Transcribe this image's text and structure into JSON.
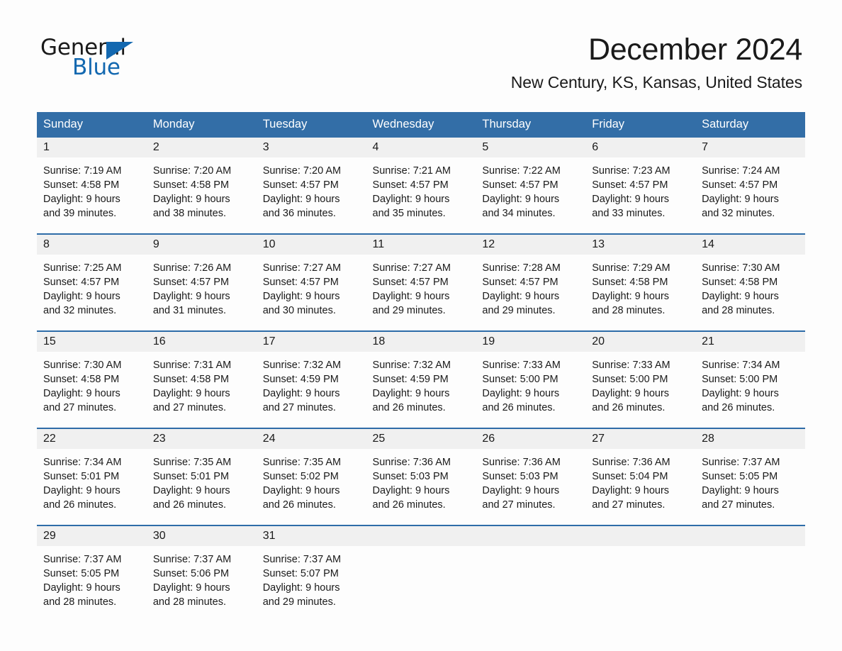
{
  "brand": {
    "word_one": "General",
    "word_two": "Blue",
    "triangle_color": "#1368b0"
  },
  "header": {
    "month_title": "December 2024",
    "location": "New Century, KS, Kansas, United States"
  },
  "theme": {
    "header_blue": "#336ea7",
    "row_divider_blue": "#2e6ca8",
    "daynum_band": "#f0f0f0",
    "page_background": "#fdfdfd",
    "text": "#1a1a1a"
  },
  "weekday_headers": [
    "Sunday",
    "Monday",
    "Tuesday",
    "Wednesday",
    "Thursday",
    "Friday",
    "Saturday"
  ],
  "labels": {
    "sunrise_prefix": "Sunrise:",
    "sunset_prefix": "Sunset:",
    "daylight_prefix": "Daylight:"
  },
  "weeks": [
    [
      {
        "day": "1",
        "line1": "Sunrise: 7:19 AM",
        "line2": "Sunset: 4:58 PM",
        "line3": "Daylight: 9 hours",
        "line4": "and 39 minutes."
      },
      {
        "day": "2",
        "line1": "Sunrise: 7:20 AM",
        "line2": "Sunset: 4:58 PM",
        "line3": "Daylight: 9 hours",
        "line4": "and 38 minutes."
      },
      {
        "day": "3",
        "line1": "Sunrise: 7:20 AM",
        "line2": "Sunset: 4:57 PM",
        "line3": "Daylight: 9 hours",
        "line4": "and 36 minutes."
      },
      {
        "day": "4",
        "line1": "Sunrise: 7:21 AM",
        "line2": "Sunset: 4:57 PM",
        "line3": "Daylight: 9 hours",
        "line4": "and 35 minutes."
      },
      {
        "day": "5",
        "line1": "Sunrise: 7:22 AM",
        "line2": "Sunset: 4:57 PM",
        "line3": "Daylight: 9 hours",
        "line4": "and 34 minutes."
      },
      {
        "day": "6",
        "line1": "Sunrise: 7:23 AM",
        "line2": "Sunset: 4:57 PM",
        "line3": "Daylight: 9 hours",
        "line4": "and 33 minutes."
      },
      {
        "day": "7",
        "line1": "Sunrise: 7:24 AM",
        "line2": "Sunset: 4:57 PM",
        "line3": "Daylight: 9 hours",
        "line4": "and 32 minutes."
      }
    ],
    [
      {
        "day": "8",
        "line1": "Sunrise: 7:25 AM",
        "line2": "Sunset: 4:57 PM",
        "line3": "Daylight: 9 hours",
        "line4": "and 32 minutes."
      },
      {
        "day": "9",
        "line1": "Sunrise: 7:26 AM",
        "line2": "Sunset: 4:57 PM",
        "line3": "Daylight: 9 hours",
        "line4": "and 31 minutes."
      },
      {
        "day": "10",
        "line1": "Sunrise: 7:27 AM",
        "line2": "Sunset: 4:57 PM",
        "line3": "Daylight: 9 hours",
        "line4": "and 30 minutes."
      },
      {
        "day": "11",
        "line1": "Sunrise: 7:27 AM",
        "line2": "Sunset: 4:57 PM",
        "line3": "Daylight: 9 hours",
        "line4": "and 29 minutes."
      },
      {
        "day": "12",
        "line1": "Sunrise: 7:28 AM",
        "line2": "Sunset: 4:57 PM",
        "line3": "Daylight: 9 hours",
        "line4": "and 29 minutes."
      },
      {
        "day": "13",
        "line1": "Sunrise: 7:29 AM",
        "line2": "Sunset: 4:58 PM",
        "line3": "Daylight: 9 hours",
        "line4": "and 28 minutes."
      },
      {
        "day": "14",
        "line1": "Sunrise: 7:30 AM",
        "line2": "Sunset: 4:58 PM",
        "line3": "Daylight: 9 hours",
        "line4": "and 28 minutes."
      }
    ],
    [
      {
        "day": "15",
        "line1": "Sunrise: 7:30 AM",
        "line2": "Sunset: 4:58 PM",
        "line3": "Daylight: 9 hours",
        "line4": "and 27 minutes."
      },
      {
        "day": "16",
        "line1": "Sunrise: 7:31 AM",
        "line2": "Sunset: 4:58 PM",
        "line3": "Daylight: 9 hours",
        "line4": "and 27 minutes."
      },
      {
        "day": "17",
        "line1": "Sunrise: 7:32 AM",
        "line2": "Sunset: 4:59 PM",
        "line3": "Daylight: 9 hours",
        "line4": "and 27 minutes."
      },
      {
        "day": "18",
        "line1": "Sunrise: 7:32 AM",
        "line2": "Sunset: 4:59 PM",
        "line3": "Daylight: 9 hours",
        "line4": "and 26 minutes."
      },
      {
        "day": "19",
        "line1": "Sunrise: 7:33 AM",
        "line2": "Sunset: 5:00 PM",
        "line3": "Daylight: 9 hours",
        "line4": "and 26 minutes."
      },
      {
        "day": "20",
        "line1": "Sunrise: 7:33 AM",
        "line2": "Sunset: 5:00 PM",
        "line3": "Daylight: 9 hours",
        "line4": "and 26 minutes."
      },
      {
        "day": "21",
        "line1": "Sunrise: 7:34 AM",
        "line2": "Sunset: 5:00 PM",
        "line3": "Daylight: 9 hours",
        "line4": "and 26 minutes."
      }
    ],
    [
      {
        "day": "22",
        "line1": "Sunrise: 7:34 AM",
        "line2": "Sunset: 5:01 PM",
        "line3": "Daylight: 9 hours",
        "line4": "and 26 minutes."
      },
      {
        "day": "23",
        "line1": "Sunrise: 7:35 AM",
        "line2": "Sunset: 5:01 PM",
        "line3": "Daylight: 9 hours",
        "line4": "and 26 minutes."
      },
      {
        "day": "24",
        "line1": "Sunrise: 7:35 AM",
        "line2": "Sunset: 5:02 PM",
        "line3": "Daylight: 9 hours",
        "line4": "and 26 minutes."
      },
      {
        "day": "25",
        "line1": "Sunrise: 7:36 AM",
        "line2": "Sunset: 5:03 PM",
        "line3": "Daylight: 9 hours",
        "line4": "and 26 minutes."
      },
      {
        "day": "26",
        "line1": "Sunrise: 7:36 AM",
        "line2": "Sunset: 5:03 PM",
        "line3": "Daylight: 9 hours",
        "line4": "and 27 minutes."
      },
      {
        "day": "27",
        "line1": "Sunrise: 7:36 AM",
        "line2": "Sunset: 5:04 PM",
        "line3": "Daylight: 9 hours",
        "line4": "and 27 minutes."
      },
      {
        "day": "28",
        "line1": "Sunrise: 7:37 AM",
        "line2": "Sunset: 5:05 PM",
        "line3": "Daylight: 9 hours",
        "line4": "and 27 minutes."
      }
    ],
    [
      {
        "day": "29",
        "line1": "Sunrise: 7:37 AM",
        "line2": "Sunset: 5:05 PM",
        "line3": "Daylight: 9 hours",
        "line4": "and 28 minutes."
      },
      {
        "day": "30",
        "line1": "Sunrise: 7:37 AM",
        "line2": "Sunset: 5:06 PM",
        "line3": "Daylight: 9 hours",
        "line4": "and 28 minutes."
      },
      {
        "day": "31",
        "line1": "Sunrise: 7:37 AM",
        "line2": "Sunset: 5:07 PM",
        "line3": "Daylight: 9 hours",
        "line4": "and 29 minutes."
      },
      {
        "day": "",
        "line1": "",
        "line2": "",
        "line3": "",
        "line4": ""
      },
      {
        "day": "",
        "line1": "",
        "line2": "",
        "line3": "",
        "line4": ""
      },
      {
        "day": "",
        "line1": "",
        "line2": "",
        "line3": "",
        "line4": ""
      },
      {
        "day": "",
        "line1": "",
        "line2": "",
        "line3": "",
        "line4": ""
      }
    ]
  ]
}
